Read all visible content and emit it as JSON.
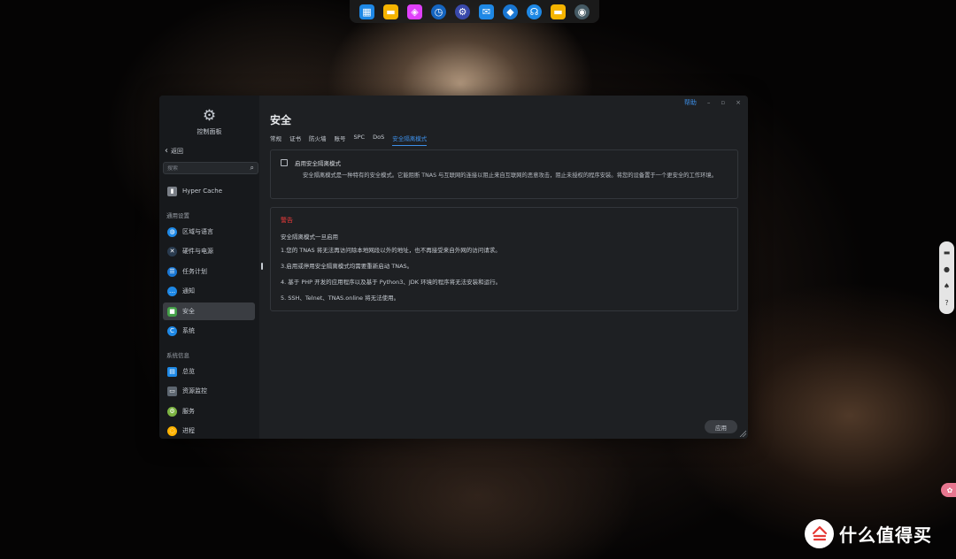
{
  "dock": {
    "items": [
      {
        "icon": "app-grid-icon",
        "color": "#1e88e5",
        "glyph": "▦"
      },
      {
        "icon": "folder-icon",
        "color": "#f5b400",
        "glyph": "▬"
      },
      {
        "icon": "app-store-icon",
        "color": "#e040fb",
        "glyph": "◈"
      },
      {
        "icon": "clock-icon",
        "color": "#1565c0",
        "glyph": "◷"
      },
      {
        "icon": "settings-gear-icon",
        "color": "#3949ab",
        "glyph": "⚙"
      },
      {
        "icon": "mail-icon",
        "color": "#1e88e5",
        "glyph": "✉"
      },
      {
        "icon": "docker-icon",
        "color": "#1976d2",
        "glyph": "◆"
      },
      {
        "icon": "headset-icon",
        "color": "#1e88e5",
        "glyph": "☊"
      },
      {
        "icon": "folder-camera-icon",
        "color": "#f5b400",
        "glyph": "▬"
      },
      {
        "icon": "camera-icon",
        "color": "#455a64",
        "glyph": "◉"
      }
    ]
  },
  "sidebar": {
    "title": "控制面板",
    "back_label": "返回",
    "search_placeholder": "搜索",
    "top_item": {
      "label": "Hyper Cache",
      "icon": "hyper-cache-icon",
      "color": "#7a7f87"
    },
    "general_section": "通用设置",
    "general_items": [
      {
        "label": "区域与语言",
        "icon": "globe-icon",
        "color": "#1e88e5",
        "glyph": "◍"
      },
      {
        "label": "硬件与电源",
        "icon": "tools-icon",
        "color": "#2a3b4f",
        "glyph": "✕"
      },
      {
        "label": "任务计划",
        "icon": "task-schedule-icon",
        "color": "#1976d2",
        "glyph": "☰"
      },
      {
        "label": "通知",
        "icon": "notification-icon",
        "color": "#1e88e5",
        "glyph": "…"
      },
      {
        "label": "安全",
        "icon": "security-lock-icon",
        "color": "#43a047",
        "glyph": "🔒"
      },
      {
        "label": "系统",
        "icon": "system-icon",
        "color": "#1e88e5",
        "glyph": "C"
      }
    ],
    "info_section": "系统信息",
    "info_items": [
      {
        "label": "总览",
        "icon": "overview-icon",
        "color": "#1e88e5",
        "glyph": "▤"
      },
      {
        "label": "资源监控",
        "icon": "resource-monitor-icon",
        "color": "#5d6670",
        "glyph": "▭"
      },
      {
        "label": "服务",
        "icon": "services-icon",
        "color": "#7cb342",
        "glyph": "⚙"
      },
      {
        "label": "进程",
        "icon": "process-icon",
        "color": "#ffb300",
        "glyph": "◌"
      }
    ]
  },
  "window": {
    "help_label": "帮助",
    "minimize_glyph": "–",
    "maximize_glyph": "▫",
    "close_glyph": "×",
    "page_title": "安全",
    "tabs": [
      {
        "label": "常规",
        "active": false
      },
      {
        "label": "证书",
        "active": false
      },
      {
        "label": "防火墙",
        "active": false
      },
      {
        "label": "账号",
        "active": false
      },
      {
        "label": "SPC",
        "active": false
      },
      {
        "label": "DoS",
        "active": false
      },
      {
        "label": "安全隔离模式",
        "active": true
      }
    ],
    "isolation": {
      "checkbox_label": "启用安全隔离模式",
      "checked": false,
      "description": "安全隔离模式是一种特有的安全模式。它能阻断 TNAS 与互联网的连接以阻止来自互联网的恶意攻击，阻止未授权的程序安装。将您的设备置于一个更安全的工作环境。"
    },
    "warning": {
      "title": "警告",
      "intro": "安全隔离模式一旦启用",
      "lines": [
        "1.您的 TNAS 将无法再访问除本地网段以外的地址，也不再接受来自外网的访问请求。",
        "3.启用或停用安全隔离模式均需要重新启动 TNAS。",
        "4. 基于 PHP 开发的应用程序以及基于 Python3、JDK 环境的程序将无法安装和运行。",
        "5. SSH、Telnet、TNAS.online 将无法使用。"
      ]
    },
    "apply_label": "应用"
  },
  "floatbar": {
    "items": [
      {
        "icon": "chat-icon",
        "glyph": "▬"
      },
      {
        "icon": "comment-icon",
        "glyph": "●"
      },
      {
        "icon": "bell-icon",
        "glyph": "♠"
      },
      {
        "icon": "help-icon",
        "glyph": "?"
      }
    ]
  },
  "watermark": {
    "text": "什么值得买",
    "logo_glyph": "值"
  },
  "colors": {
    "accent": "#3d8fe8",
    "warning": "#e83a3a",
    "window_bg": "#1e2023",
    "sidebar_bg": "#17191c"
  }
}
